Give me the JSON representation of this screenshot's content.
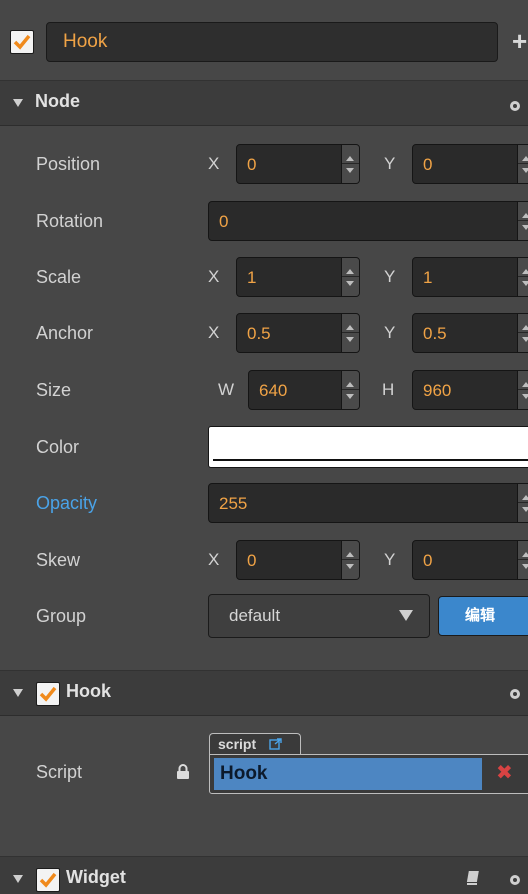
{
  "node_name": {
    "checked": true,
    "value": "Hook"
  },
  "node_section": {
    "title": "Node"
  },
  "props": {
    "position": {
      "label": "Position",
      "x_axis": "X",
      "x": "0",
      "y_axis": "Y",
      "y": "0"
    },
    "rotation": {
      "label": "Rotation",
      "value": "0"
    },
    "scale": {
      "label": "Scale",
      "x_axis": "X",
      "x": "1",
      "y_axis": "Y",
      "y": "1"
    },
    "anchor": {
      "label": "Anchor",
      "x_axis": "X",
      "x": "0.5",
      "y_axis": "Y",
      "y": "0.5"
    },
    "size": {
      "label": "Size",
      "w_axis": "W",
      "w": "640",
      "h_axis": "H",
      "h": "960"
    },
    "color": {
      "label": "Color",
      "value": "#ffffff"
    },
    "opacity": {
      "label": "Opacity",
      "value": "255"
    },
    "skew": {
      "label": "Skew",
      "x_axis": "X",
      "x": "0",
      "y_axis": "Y",
      "y": "0"
    },
    "group": {
      "label": "Group",
      "value": "default",
      "edit_label": "编辑"
    }
  },
  "hook_component": {
    "title": "Hook",
    "checked": true,
    "script_label": "Script",
    "script_tag": "script",
    "script_value": "Hook",
    "clear_symbol": "✖"
  },
  "widget_component": {
    "title": "Widget",
    "checked": true
  },
  "colors": {
    "accent_orange": "#f0a346",
    "accent_blue": "#3b87cc",
    "label_blue": "#4aa3e8",
    "background": "#474747"
  }
}
